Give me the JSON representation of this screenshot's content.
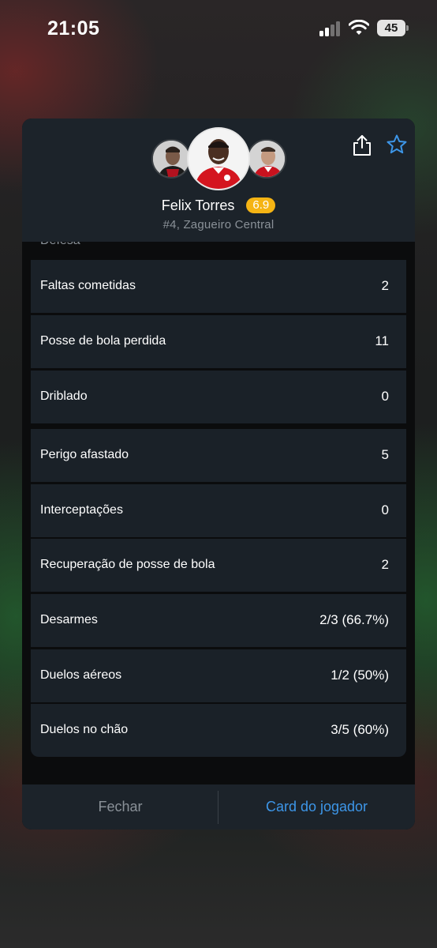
{
  "status_bar": {
    "time": "21:05",
    "battery": "45"
  },
  "header": {
    "player_name": "Felix Torres",
    "rating": "6.9",
    "player_info": "#4, Zagueiro Central",
    "rating_color": "#f5b414"
  },
  "stats": {
    "section_partial": "Defesa",
    "rows": [
      {
        "label": "Faltas cometidas",
        "value": "2"
      },
      {
        "label": "Posse de bola perdida",
        "value": "11"
      },
      {
        "label": "Driblado",
        "value": "0"
      },
      {
        "label": "Perigo afastado",
        "value": "5"
      },
      {
        "label": "Interceptações",
        "value": "0"
      },
      {
        "label": "Recuperação de posse de bola",
        "value": "2"
      },
      {
        "label": "Desarmes",
        "value": "2/3 (66.7%)"
      },
      {
        "label": "Duelos aéreos",
        "value": "1/2 (50%)"
      },
      {
        "label": "Duelos no chão",
        "value": "3/5 (60%)"
      }
    ]
  },
  "footer": {
    "close_label": "Fechar",
    "card_label": "Card do jogador",
    "accent_color": "#3d96e8"
  }
}
